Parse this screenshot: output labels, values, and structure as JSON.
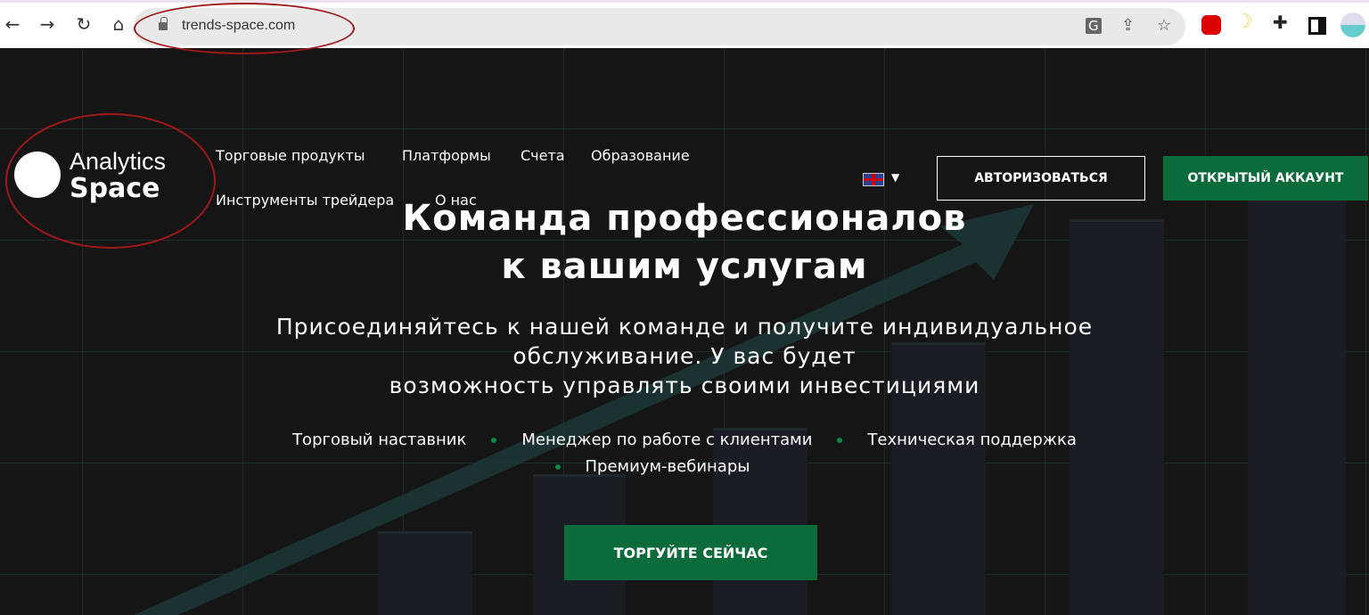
{
  "browser": {
    "url": "trends-space.com",
    "icons": [
      "back-icon",
      "forward-icon",
      "reload-icon",
      "home-icon",
      "lock-icon",
      "translate-icon",
      "share-icon",
      "star-icon",
      "adblock-icon",
      "moon-icon",
      "puzzle-icon",
      "sidepanel-icon",
      "profile-avatar"
    ]
  },
  "logo": {
    "line1": "Analytics",
    "line2": "Space"
  },
  "nav": [
    "Торговые продукты",
    "Платформы",
    "Счета",
    "Образование",
    "Инструменты трейдера",
    "О нас"
  ],
  "language": "en-gb-flag",
  "login_label": "АВТОРИЗОВАТЬСЯ",
  "open_account_label": "ОТКРЫТЫЙ АККАУНТ",
  "hero": {
    "title_line1": "Команда профессионалов",
    "title_line2": "к вашим услугам",
    "sub1": "Присоединяйтесь к нашей команде и получите индивидуальное",
    "sub2": "обслуживание. У вас будет",
    "sub3": "возможность управлять своими инвестициями",
    "features": [
      "Торговый наставник",
      "Менеджер по работе с клиентами",
      "Техническая поддержка",
      "Премиум-вебинары"
    ],
    "cta": "ТОРГУЙТЕ СЕЙЧАС"
  },
  "colors": {
    "accent": "#0b6b3a",
    "background": "#151515",
    "annotation": "#a01818"
  }
}
